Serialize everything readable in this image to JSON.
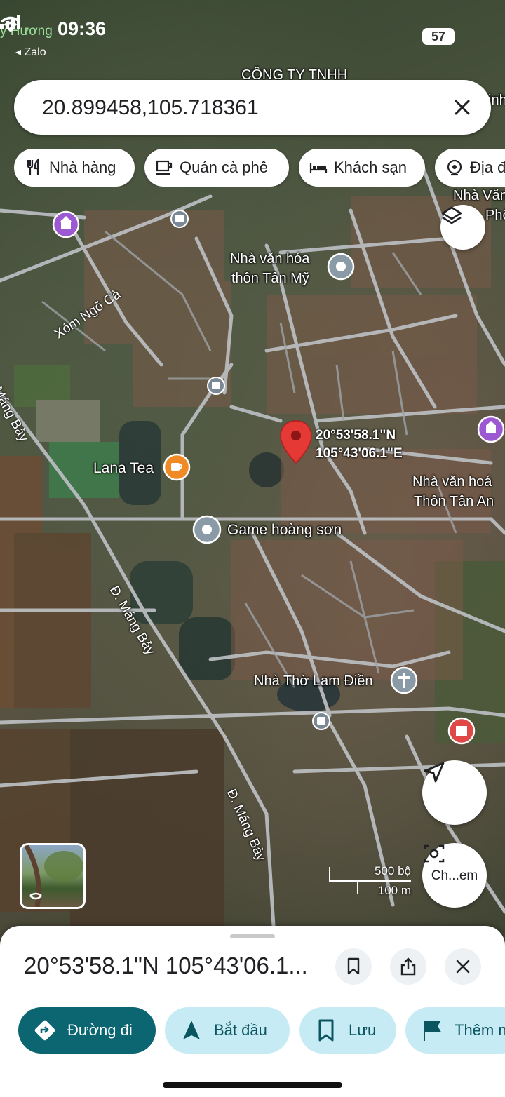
{
  "status_bar": {
    "time": "09:36",
    "back_label": "◂ Zalo",
    "app_label": "y Hương",
    "battery": "57"
  },
  "search": {
    "value": "20.899458,105.718361"
  },
  "chips": [
    {
      "label": "Nhà hàng",
      "icon": "restaurant-icon"
    },
    {
      "label": "Quán cà phê",
      "icon": "cafe-icon"
    },
    {
      "label": "Khách sạn",
      "icon": "hotel-icon"
    },
    {
      "label": "Địa đ",
      "icon": "attraction-icon"
    }
  ],
  "map": {
    "place_labels": {
      "cong_ty": "CÔNG TY TNHH",
      "nha_van_hoa_tan_my_1": "Nhà văn hóa",
      "nha_van_hoa_tan_my_2": "thôn Tân Mỹ",
      "nha_van_top_right_1": "Nhà Văn",
      "nha_van_top_right_2": "Phố",
      "xom_ngo_ca": "Xóm Ngõ Cà",
      "lana_tea": "Lana Tea",
      "game_hoang_son": "Game hoàng sơn",
      "nha_van_hoa_tan_an_1": "Nhà văn hoá",
      "nha_van_hoa_tan_an_2": "Thôn Tân An",
      "nha_tho_lam_dien": "Nhà Thờ Lam Điền",
      "road_mang_bay_1": "Máng Bảy",
      "road_mang_bay_2": "Đ. Máng Bảy",
      "road_mang_bay_3": "Đ. Máng Bảy",
      "top_right_edge": "inh"
    },
    "pin": {
      "lat_label": "20°53'58.1\"N",
      "lng_label": "105°43'06.1\"E"
    },
    "scale": {
      "imperial": "500 bộ",
      "metric": "100 m"
    },
    "camera_button_label": "Ch...em"
  },
  "sheet": {
    "title": "20°53'58.1\"N 105°43'06.1...",
    "actions": [
      {
        "label": "Đường đi",
        "icon": "directions-icon"
      },
      {
        "label": "Bắt đầu",
        "icon": "navigate-icon"
      },
      {
        "label": "Lưu",
        "icon": "bookmark-icon"
      },
      {
        "label": "Thêm n",
        "icon": "flag-icon"
      }
    ]
  },
  "colors": {
    "primary": "#0b6672",
    "secondary_bg": "#c7ebf4",
    "pin": "#e53935",
    "poi_purple": "#9c59d1",
    "poi_orange": "#f08a24",
    "poi_gray": "#8a9aa6",
    "poi_red": "#e04848"
  }
}
